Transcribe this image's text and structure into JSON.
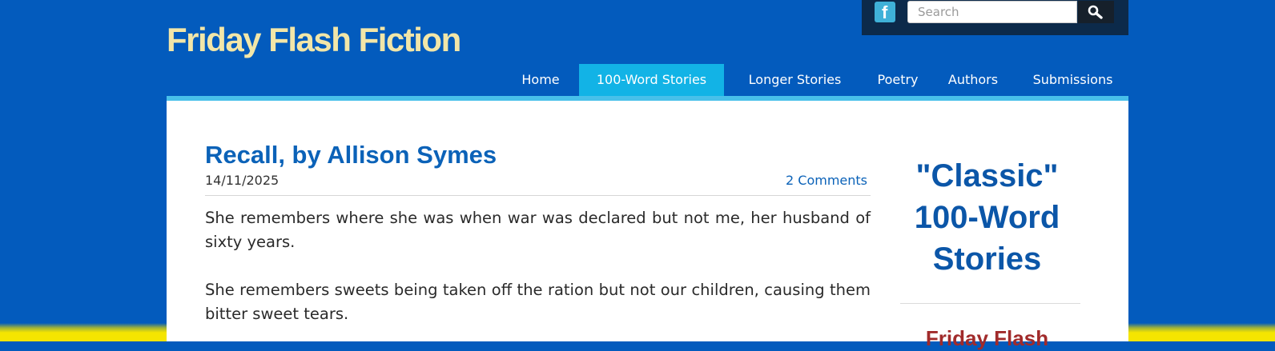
{
  "site": {
    "title": "Friday Flash Fiction"
  },
  "search": {
    "placeholder": "Search"
  },
  "social": {
    "facebook_glyph": "f"
  },
  "nav": {
    "items": [
      {
        "label": "Home"
      },
      {
        "label": "100-Word Stories",
        "active": true
      },
      {
        "label": "Longer Stories"
      },
      {
        "label": "Poetry"
      },
      {
        "label": "Authors"
      },
      {
        "label": "Submissions"
      }
    ]
  },
  "post": {
    "title": "Recall, by Allison Symes",
    "date": "14/11/2025",
    "comments": "2 Comments",
    "paragraphs": [
      "She remembers where she was when war was declared but not me, her husband of sixty years.",
      "She remembers sweets being taken off the ration but not our children, causing them bitter sweet tears."
    ]
  },
  "sidebar": {
    "heading": "\"Classic\" 100-Word Stories",
    "subheading": "Friday Flash"
  },
  "colors": {
    "background": "#035bbd",
    "title": "#f2e6a8",
    "nav_active": "#12b3e6",
    "link": "#0b62b8",
    "sidebar_heading": "#0b56a8",
    "sidebar_sub": "#a12b2b"
  },
  "icons": {
    "search_button": "magnifier-icon",
    "social": "facebook-icon"
  }
}
